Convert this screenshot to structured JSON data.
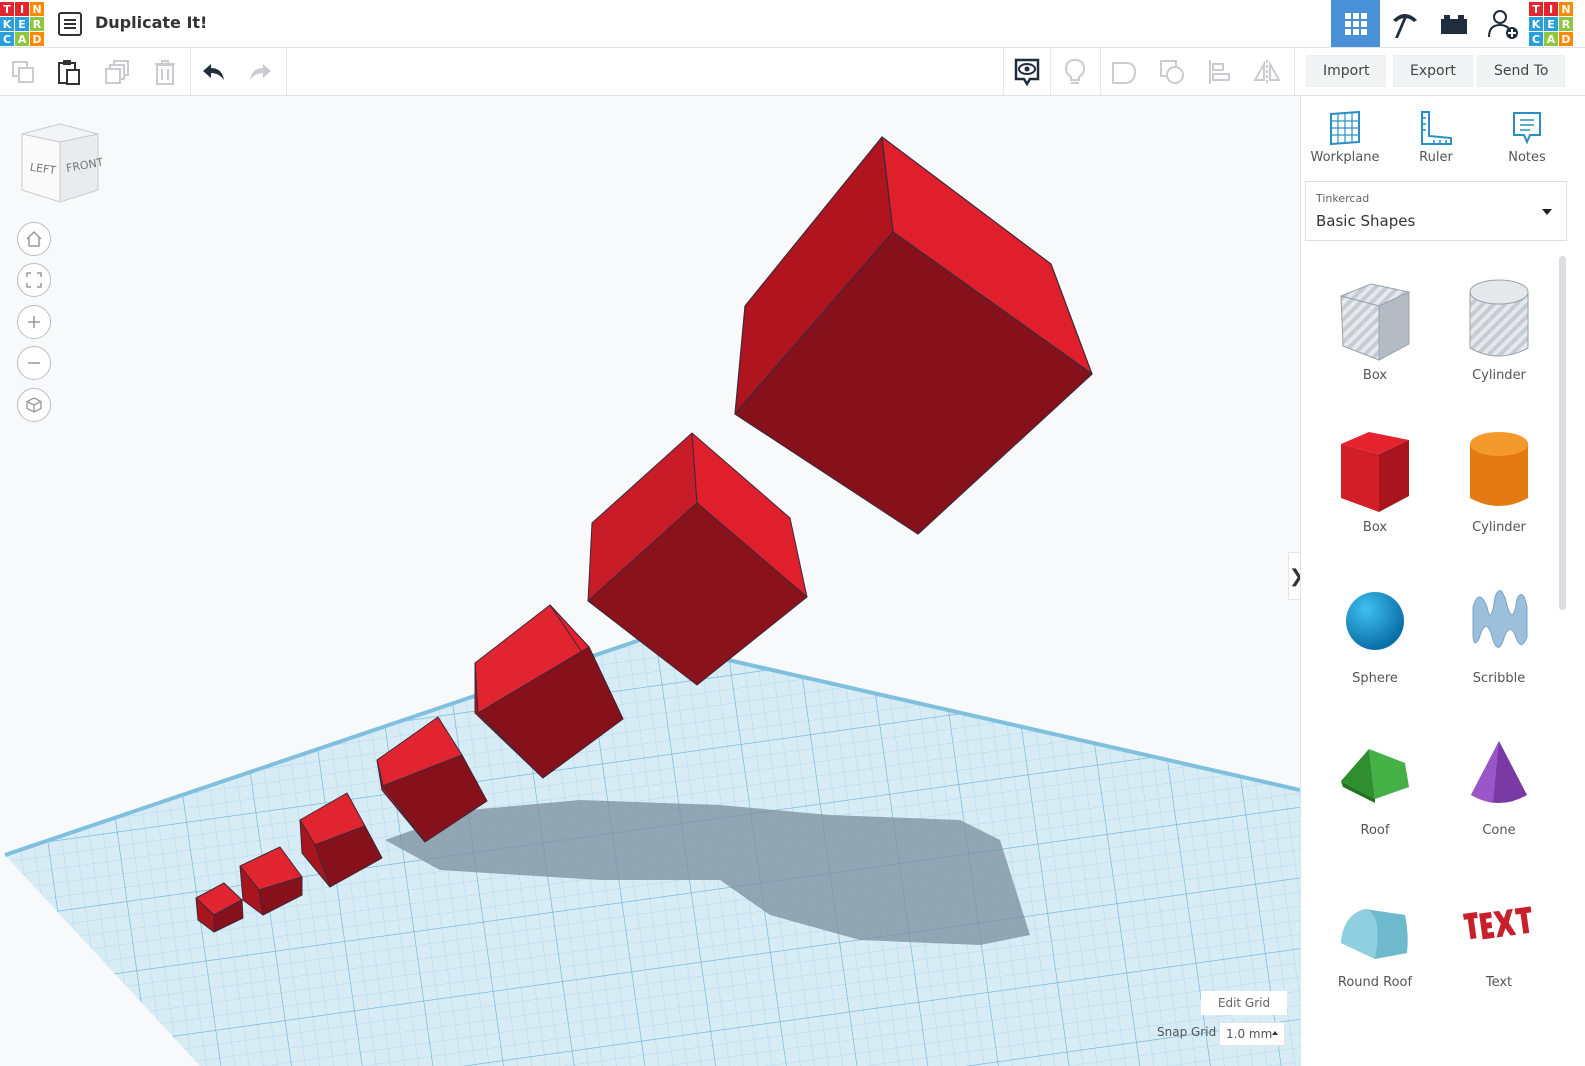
{
  "app": {
    "logo_letters": [
      "T",
      "I",
      "N",
      "K",
      "E",
      "R",
      "C",
      "A",
      "D"
    ],
    "logo_colors": [
      "#e3262e",
      "#e3262e",
      "#ff8a00",
      "#2b9fdb",
      "#2b9fdb",
      "#8ec63f",
      "#2b9fdb",
      "#8ec63f",
      "#ff8a00"
    ]
  },
  "header": {
    "title": "Duplicate It!",
    "views": [
      {
        "name": "3d-design-view",
        "icon": "grid-icon",
        "active": true
      },
      {
        "name": "codeblocks-view",
        "icon": "pickaxe-icon",
        "active": false
      },
      {
        "name": "bricks-view",
        "icon": "brick-icon",
        "active": false
      }
    ],
    "account_icon": "add-user-icon"
  },
  "toolbar": {
    "edit_tools": [
      "copy-icon",
      "paste-icon",
      "duplicate-icon",
      "delete-icon",
      "undo-icon",
      "redo-icon"
    ],
    "view_tools": [
      "show-all-icon",
      "light-bulb-icon",
      "group-icon",
      "ungroup-icon",
      "align-icon",
      "mirror-icon"
    ],
    "actions": {
      "import": "Import",
      "export": "Export",
      "send_to": "Send To"
    }
  },
  "viewport": {
    "viewcube": {
      "left": "LEFT",
      "front": "FRONT"
    },
    "nav_buttons": [
      "home-icon",
      "fit-view-icon",
      "zoom-in-icon",
      "zoom-out-icon",
      "ortho-view-icon"
    ],
    "panel_toggle": "❯",
    "edit_grid": "Edit Grid",
    "snap_grid_label": "Snap Grid",
    "snap_grid_value": "1.0 mm"
  },
  "panel": {
    "tools": {
      "workplane": "Workplane",
      "ruler": "Ruler",
      "notes": "Notes"
    },
    "library": {
      "category": "Tinkercad",
      "name": "Basic Shapes"
    },
    "shapes": [
      {
        "label": "Box",
        "icon": "hole-box-icon"
      },
      {
        "label": "Cylinder",
        "icon": "hole-cylinder-icon"
      },
      {
        "label": "Box",
        "icon": "box-icon"
      },
      {
        "label": "Cylinder",
        "icon": "cylinder-icon"
      },
      {
        "label": "Sphere",
        "icon": "sphere-icon"
      },
      {
        "label": "Scribble",
        "icon": "scribble-icon"
      },
      {
        "label": "Roof",
        "icon": "roof-icon"
      },
      {
        "label": "Cone",
        "icon": "cone-icon"
      },
      {
        "label": "Round Roof",
        "icon": "round-roof-icon"
      },
      {
        "label": "Text",
        "icon": "text-icon"
      }
    ]
  },
  "colors": {
    "accent": "#4a90d9",
    "cube_red": "#c8202b",
    "workplane": "#cfe6f2"
  }
}
